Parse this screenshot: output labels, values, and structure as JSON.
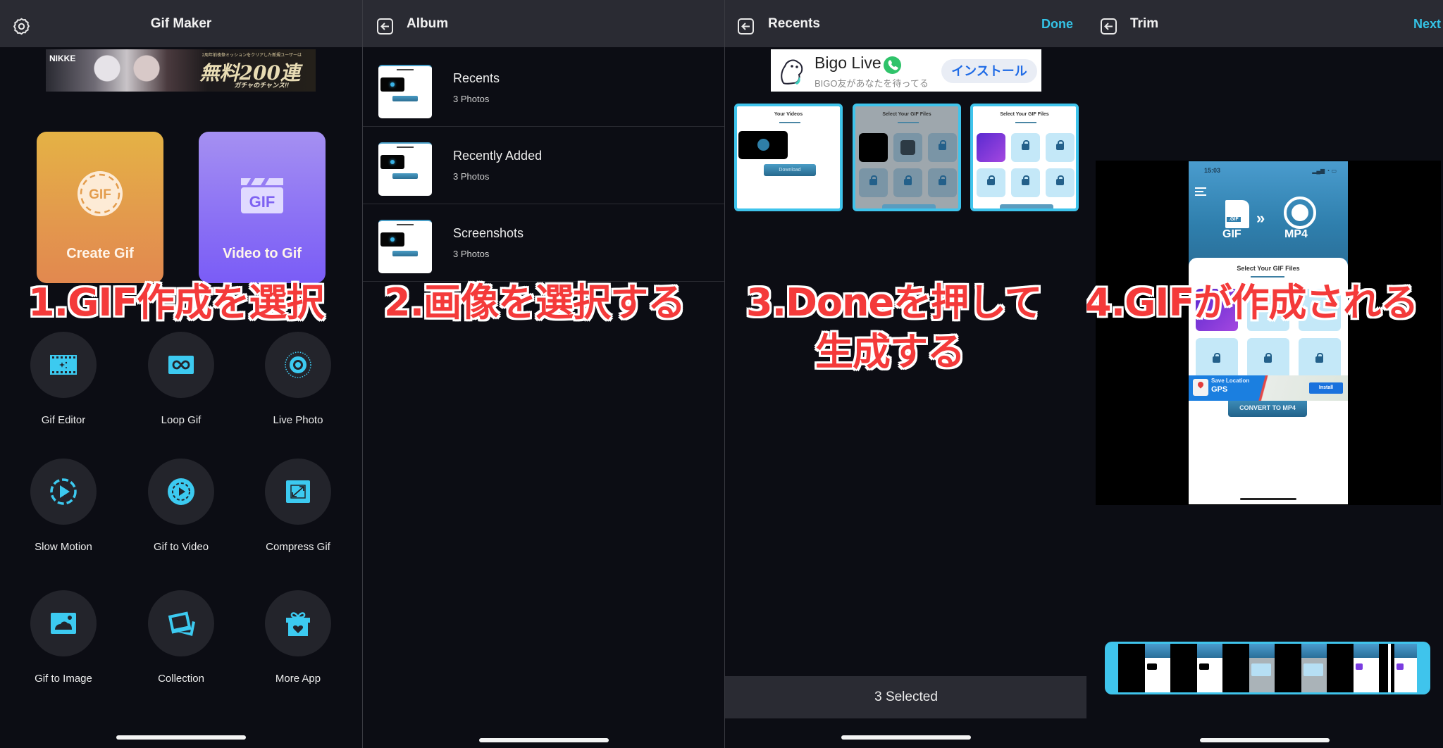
{
  "panels": {
    "gif_maker": {
      "title": "Gif Maker",
      "ad": {
        "brand": "NIKKE",
        "headline": "無料200連",
        "subline": "2周年前夜祭ミッションをクリアした新規ユーザーは",
        "note": "ガチャのチャンス!!"
      },
      "cards": [
        {
          "label": "Create Gif",
          "icon": "gif-badge-icon",
          "color": "#e3a04a"
        },
        {
          "label": "Video to Gif",
          "icon": "gif-clapper-icon",
          "color": "#8c72f4"
        }
      ],
      "tools": [
        {
          "label": "Gif Editor",
          "icon": "film-sparkle-icon"
        },
        {
          "label": "Loop Gif",
          "icon": "infinity-icon"
        },
        {
          "label": "Live Photo",
          "icon": "live-photo-icon"
        },
        {
          "label": "Slow Motion",
          "icon": "slow-motion-icon"
        },
        {
          "label": "Gif to Video",
          "icon": "play-circle-icon"
        },
        {
          "label": "Compress Gif",
          "icon": "compress-icon"
        },
        {
          "label": "Gif to Image",
          "icon": "image-icon"
        },
        {
          "label": "Collection",
          "icon": "photo-stack-icon"
        },
        {
          "label": "More App",
          "icon": "gift-icon"
        }
      ],
      "caption": "1.GIF作成を選択"
    },
    "album": {
      "title": "Album",
      "albums": [
        {
          "name": "Recents",
          "count": "3 Photos"
        },
        {
          "name": "Recently Added",
          "count": "3 Photos"
        },
        {
          "name": "Screenshots",
          "count": "3 Photos"
        }
      ],
      "caption": "2.画像を選択する"
    },
    "recents": {
      "title": "Recents",
      "done_label": "Done",
      "ad": {
        "name": "Bigo Live",
        "tagline": "BIGO友があなたを待ってる",
        "install_label": "インストール"
      },
      "thumbnails": [
        {
          "title": "Your Videos",
          "button": "Download",
          "selected": true
        },
        {
          "title": "Select Your GIF Files",
          "selected": true
        },
        {
          "title": "Select Your GIF Files",
          "selected": true
        }
      ],
      "selected_count_label": "3 Selected",
      "caption_line1": "3.Doneを押して",
      "caption_line2": "生成する"
    },
    "trim": {
      "title": "Trim",
      "next_label": "Next",
      "preview": {
        "time": "15:03",
        "from_label": "GIF",
        "to_label": "MP4",
        "file_badge": ".GIF",
        "sheet_title": "Select Your GIF Files",
        "convert_label": "CONVERT TO MP4",
        "ad_line1": "Save Location",
        "ad_line2": "GPS",
        "ad_install": "Install"
      },
      "caption": "4.GIFが作成される"
    }
  },
  "colors": {
    "accent": "#34c3e6",
    "header_bg": "#2a2b33",
    "body_bg": "#0c0d14",
    "caption_red": "#f43a3a"
  }
}
